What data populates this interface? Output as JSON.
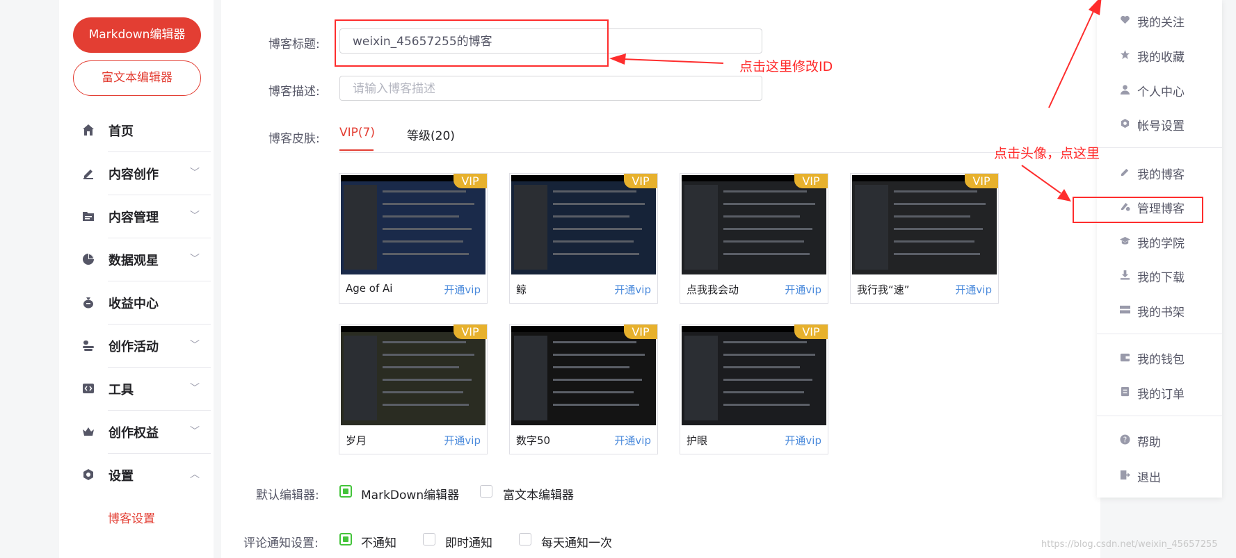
{
  "sidebar": {
    "markdown_button": "Markdown编辑器",
    "richtext_button": "富文本编辑器",
    "nav": [
      {
        "label": "首页",
        "icon": "home-icon",
        "expandable": false
      },
      {
        "label": "内容创作",
        "icon": "pencil-icon",
        "expandable": true
      },
      {
        "label": "内容管理",
        "icon": "folder-icon",
        "expandable": true
      },
      {
        "label": "数据观星",
        "icon": "pie-chart-icon",
        "expandable": true
      },
      {
        "label": "收益中心",
        "icon": "money-bag-icon",
        "expandable": false
      },
      {
        "label": "创作活动",
        "icon": "activity-icon",
        "expandable": true
      },
      {
        "label": "工具",
        "icon": "code-tool-icon",
        "expandable": true
      },
      {
        "label": "创作权益",
        "icon": "crown-icon",
        "expandable": true
      },
      {
        "label": "设置",
        "icon": "settings-icon",
        "expandable": true,
        "expanded": true
      }
    ],
    "sub_item": "博客设置"
  },
  "form": {
    "title_label": "博客标题:",
    "title_value": "weixin_45657255的博客",
    "desc_label": "博客描述:",
    "desc_placeholder": "请输入博客描述",
    "skin_label": "博客皮肤:",
    "tabs": [
      "VIP(7)",
      "等级(20)"
    ],
    "editor_label": "默认编辑器:",
    "editor_options": [
      {
        "label": "MarkDown编辑器",
        "checked": true
      },
      {
        "label": "富文本编辑器",
        "checked": false
      }
    ],
    "comment_label": "评论通知设置:",
    "comment_options": [
      {
        "label": "不通知",
        "checked": true
      },
      {
        "label": "即时通知",
        "checked": false
      },
      {
        "label": "每天通知一次",
        "checked": false
      }
    ]
  },
  "skins": [
    {
      "name": "Age of Ai",
      "badge": "VIP",
      "action": "开通vip",
      "bg": "#1a2a4a"
    },
    {
      "name": "鲸",
      "badge": "VIP",
      "action": "开通vip",
      "bg": "#162338"
    },
    {
      "name": "点我我会动",
      "badge": "VIP",
      "action": "开通vip",
      "bg": "#1f2124"
    },
    {
      "name": "我行我“速”",
      "badge": "VIP",
      "action": "开通vip",
      "bg": "#222325"
    },
    {
      "name": "岁月",
      "badge": "VIP",
      "action": "开通vip",
      "bg": "#2a2c22"
    },
    {
      "name": "数字50",
      "badge": "VIP",
      "action": "开通vip",
      "bg": "#141414"
    },
    {
      "name": "护眼",
      "badge": "VIP",
      "action": "开通vip",
      "bg": "#1b1c1f"
    }
  ],
  "dropdown": {
    "items": [
      {
        "label": "我的关注",
        "icon": "heart-icon"
      },
      {
        "label": "我的收藏",
        "icon": "star-icon"
      },
      {
        "label": "个人中心",
        "icon": "user-icon"
      },
      {
        "label": "帐号设置",
        "icon": "gear-icon"
      },
      {
        "label": "我的博客",
        "icon": "pen-icon"
      },
      {
        "label": "管理博客",
        "icon": "manage-blog-icon"
      },
      {
        "label": "我的学院",
        "icon": "graduation-cap-icon"
      },
      {
        "label": "我的下载",
        "icon": "download-icon"
      },
      {
        "label": "我的书架",
        "icon": "bookshelf-icon"
      },
      {
        "label": "我的钱包",
        "icon": "wallet-icon"
      },
      {
        "label": "我的订单",
        "icon": "order-icon"
      },
      {
        "label": "帮助",
        "icon": "help-icon"
      },
      {
        "label": "退出",
        "icon": "logout-icon"
      }
    ]
  },
  "annotations": {
    "modify_id": "点击这里修改ID",
    "click_avatar": "点击头像，点这里"
  },
  "watermark": "https://blog.csdn.net/weixin_45657255",
  "colors": {
    "accent": "#e33e33",
    "vip": "#e7b12d",
    "link": "#4c8bdc",
    "check": "#43c43a",
    "annotation": "#fe2d2d"
  }
}
